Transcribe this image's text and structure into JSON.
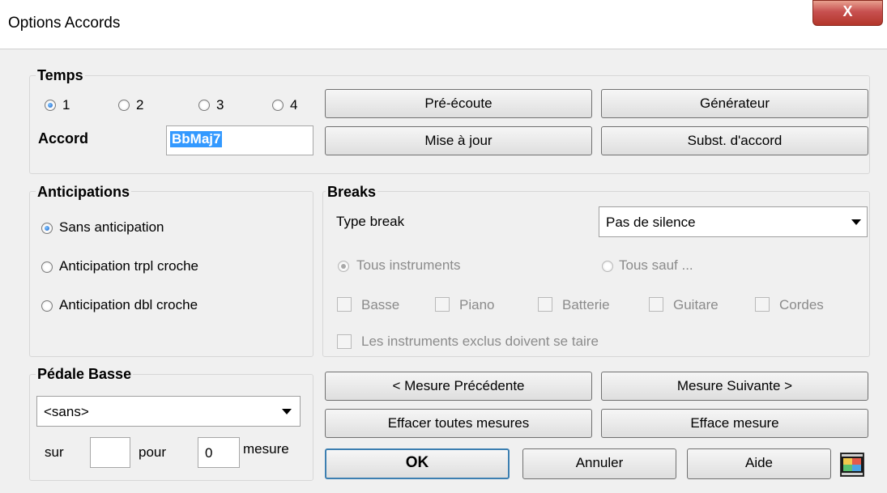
{
  "window": {
    "title": "Options Accords",
    "close_label": "X"
  },
  "temps": {
    "label": "Temps",
    "radios": [
      "1",
      "2",
      "3",
      "4"
    ],
    "accord_label": "Accord",
    "accord_value": "BbMaj7"
  },
  "buttons": {
    "pre_ecoute": "Pré-écoute",
    "generateur": "Générateur",
    "mise_a_jour": "Mise à jour",
    "subst": "Subst. d'accord",
    "precedente": "< Mesure Précédente",
    "suivante": "Mesure Suivante >",
    "effacer_toutes": "Effacer toutes mesures",
    "efface": "Efface mesure",
    "ok": "OK",
    "annuler": "Annuler",
    "aide": "Aide"
  },
  "anticipations": {
    "label": "Anticipations",
    "options": [
      "Sans anticipation",
      "Anticipation trpl croche",
      "Anticipation dbl croche"
    ]
  },
  "breaks": {
    "label": "Breaks",
    "type_label": "Type break",
    "type_value": "Pas de silence",
    "tous_instruments": "Tous instruments",
    "tous_sauf": "Tous sauf ...",
    "instruments": [
      "Basse",
      "Piano",
      "Batterie",
      "Guitare",
      "Cordes"
    ],
    "exclus": "Les instruments exclus doivent se taire"
  },
  "pedale": {
    "label": "Pédale Basse",
    "value": "<sans>",
    "sur_label": "sur",
    "sur_value": "",
    "pour_label": "pour",
    "pour_value": "0",
    "mesure_label": "mesure"
  }
}
